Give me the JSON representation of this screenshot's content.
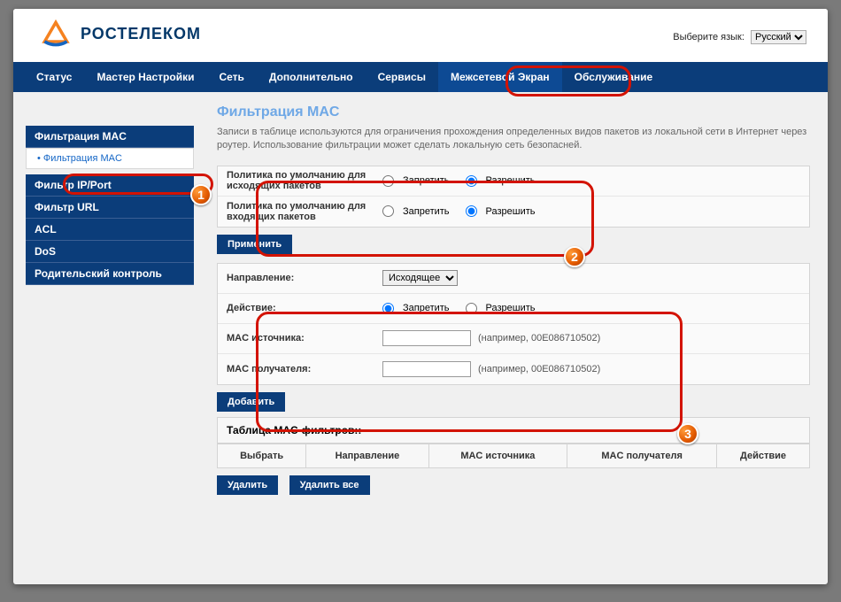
{
  "header": {
    "brand": "РОСТЕЛЕКОМ",
    "lang_label": "Выберите язык:",
    "lang_value": "Русский"
  },
  "nav": {
    "status": "Статус",
    "wizard": "Мастер Настройки",
    "network": "Сеть",
    "advanced": "Дополнительно",
    "services": "Сервисы",
    "firewall": "Межсетевой Экран",
    "maintenance": "Обслуживание"
  },
  "sidebar": {
    "mac_filtering": "Фильтрация MAC",
    "mac_filtering_sub": "Фильтрация MAC",
    "ip_port_filter": "Фильтр IP/Port",
    "url_filter": "Фильтр URL",
    "acl": "ACL",
    "dos": "DoS",
    "parental": "Родительский контроль"
  },
  "content": {
    "title": "Фильтрация MAC",
    "desc": "Записи в таблице используются для ограничения прохождения определенных видов пакетов из локальной сети в Интернет через роутер. Использование фильтрации может сделать локальную сеть безопасней.",
    "policy_out": "Политика по умолчанию для исходящих пакетов",
    "policy_in": "Политика по умолчанию для входящих пакетов",
    "deny": "Запретить",
    "allow": "Разрешить",
    "apply": "Применить",
    "direction": "Направление:",
    "direction_value": "Исходящее",
    "action": "Действие:",
    "mac_src": "MAC источника:",
    "mac_dst": "MAC получателя:",
    "example": "(например, 00E086710502)",
    "add": "Добавить",
    "table_title": "Таблица MAC-фильтров::",
    "cols": {
      "select": "Выбрать",
      "direction": "Направление",
      "mac_src": "MAC источника",
      "mac_dst": "MAC получателя",
      "action": "Действие"
    },
    "delete": "Удалить",
    "delete_all": "Удалить все"
  }
}
